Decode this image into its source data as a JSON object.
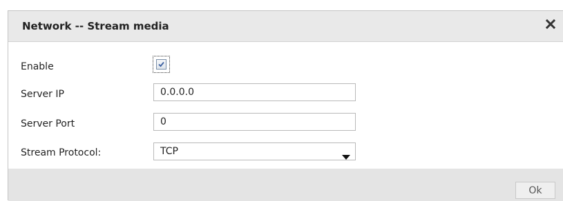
{
  "dialog": {
    "title": "Network -- Stream media",
    "close_icon": "close-x-icon"
  },
  "form": {
    "enable": {
      "label": "Enable",
      "checked": true
    },
    "server_ip": {
      "label": "Server IP",
      "value": "0.0.0.0"
    },
    "server_port": {
      "label": "Server Port",
      "value": "0"
    },
    "stream_protocol": {
      "label": "Stream Protocol:",
      "selected": "TCP",
      "arrow_icon": "chevron-down-icon"
    }
  },
  "footer": {
    "ok_label": "Ok"
  },
  "colors": {
    "titlebar_bg": "#e9e9e9",
    "footer_bg": "#e4e4e4",
    "text": "#222222",
    "checkmark": "#3a5fa0"
  }
}
